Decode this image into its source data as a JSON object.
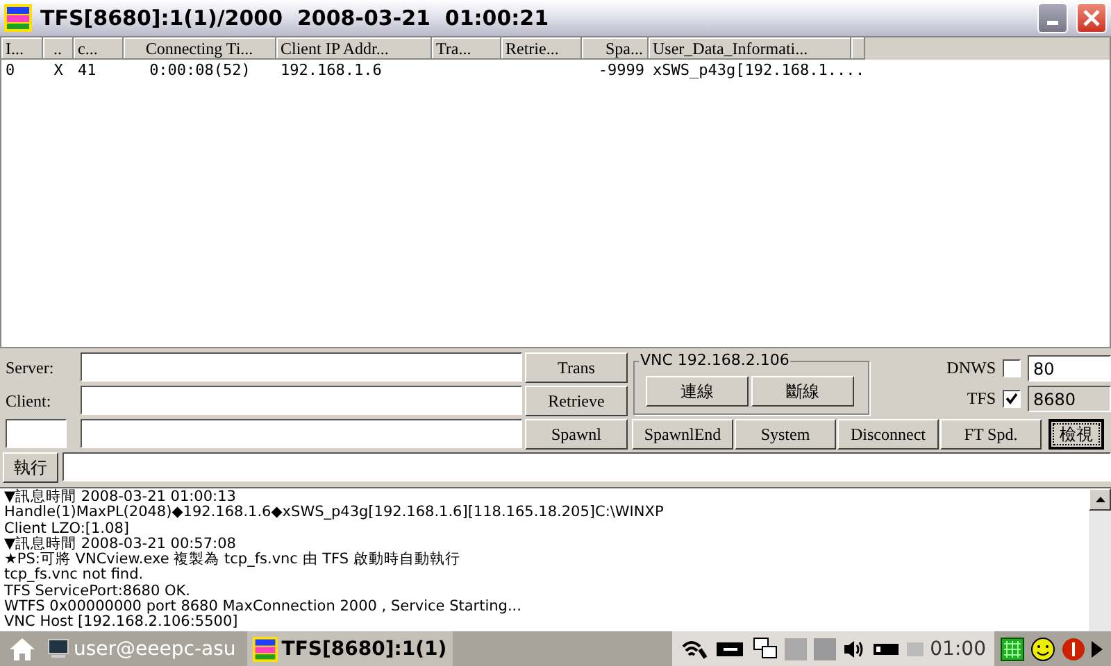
{
  "window": {
    "title": "TFS[8680]:1(1)/2000  2008-03-21  01:00:21"
  },
  "table": {
    "columns": [
      "I...",
      "..",
      "c...",
      "Connecting Ti...",
      "Client IP Addr...",
      "Tra...",
      "Retrie...",
      "Spa...",
      "User_Data_Informati..."
    ],
    "rows": [
      {
        "cells": [
          "0",
          "X",
          "41",
          "0:00:08(52)",
          "192.168.1.6",
          "",
          "",
          "-9999",
          "xSWS_p43g[192.168.1...",
          "."
        ]
      }
    ]
  },
  "controls": {
    "server_label": "Server:",
    "client_label": "Client:",
    "buttons_right": [
      "Trans",
      "Retrieve"
    ],
    "vnc": {
      "title": "VNC 192.168.2.106",
      "buttons": [
        "連線",
        "斷線"
      ]
    },
    "toggles": [
      {
        "label": "DNWS",
        "checked": false,
        "port": "80",
        "disabled": false
      },
      {
        "label": "TFS",
        "checked": true,
        "port": "8680",
        "disabled": true
      }
    ],
    "row_buttons": [
      {
        "label": "Spawnl",
        "focused": false
      },
      {
        "label": "SpawnlEnd",
        "focused": false
      },
      {
        "label": "System",
        "focused": false
      },
      {
        "label": "Disconnect",
        "focused": false
      },
      {
        "label": "FT Spd.",
        "focused": false
      },
      {
        "label": "檢視",
        "focused": true
      }
    ],
    "run_button": "執行"
  },
  "log": [
    "▼訊息時間 2008-03-21 01:00:13",
    "Handle(1)MaxPL(2048)◆192.168.1.6◆xSWS_p43g[192.168.1.6][118.165.18.205]C:\\WINXP",
    "Client LZO:[1.08]",
    "▼訊息時間 2008-03-21 00:57:08",
    "★PS:可將 VNCview.exe 複製為 tcp_fs.vnc 由 TFS 啟動時自動執行",
    "tcp_fs.vnc not find.",
    "TFS ServicePort:8680 OK.",
    "WTFS 0x00000000 port 8680 MaxConnection 2000 , Service Starting...",
    "VNC Host [192.168.2.106:5500]"
  ],
  "taskbar": {
    "tasks": [
      {
        "label": "user@eeepc-asu",
        "kind": "terminal",
        "selected": false
      },
      {
        "label": "TFS[8680]:1(1)",
        "kind": "app",
        "selected": true
      }
    ],
    "clock": "01:00"
  }
}
